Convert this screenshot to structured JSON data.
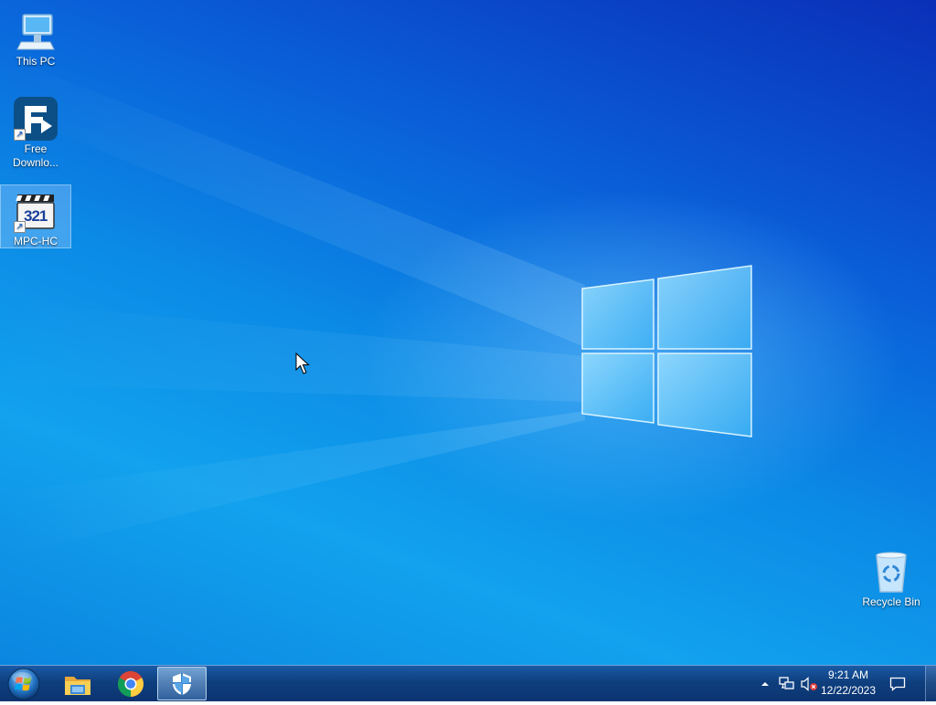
{
  "desktop": {
    "icons": [
      {
        "label": "This PC",
        "icon": "computer-icon"
      },
      {
        "label": "Free Downlo...",
        "icon": "free-download-manager-icon"
      },
      {
        "label": "MPC-HC",
        "icon": "mpc-hc-icon",
        "selected": true
      },
      {
        "label": "Recycle Bin",
        "icon": "recycle-bin-icon"
      }
    ],
    "mpc_logo_text": "321"
  },
  "taskbar": {
    "start": {
      "icon": "windows-start-orb-icon"
    },
    "pinned": [
      {
        "name": "File Explorer",
        "icon": "folder-icon"
      },
      {
        "name": "Google Chrome",
        "icon": "chrome-icon"
      },
      {
        "name": "Windows Security",
        "icon": "shield-icon",
        "active": true
      }
    ],
    "tray": {
      "icons": [
        "show-hidden-icons-chevron-icon",
        "network-icon",
        "volume-muted-icon"
      ],
      "time": "9:21 AM",
      "date": "12/22/2023",
      "notification_icon": "action-center-icon"
    }
  },
  "colors": {
    "desktop_dark": "#0a2fb8",
    "desktop_light": "#12a2ee",
    "taskbar": "#0f3f7e"
  }
}
